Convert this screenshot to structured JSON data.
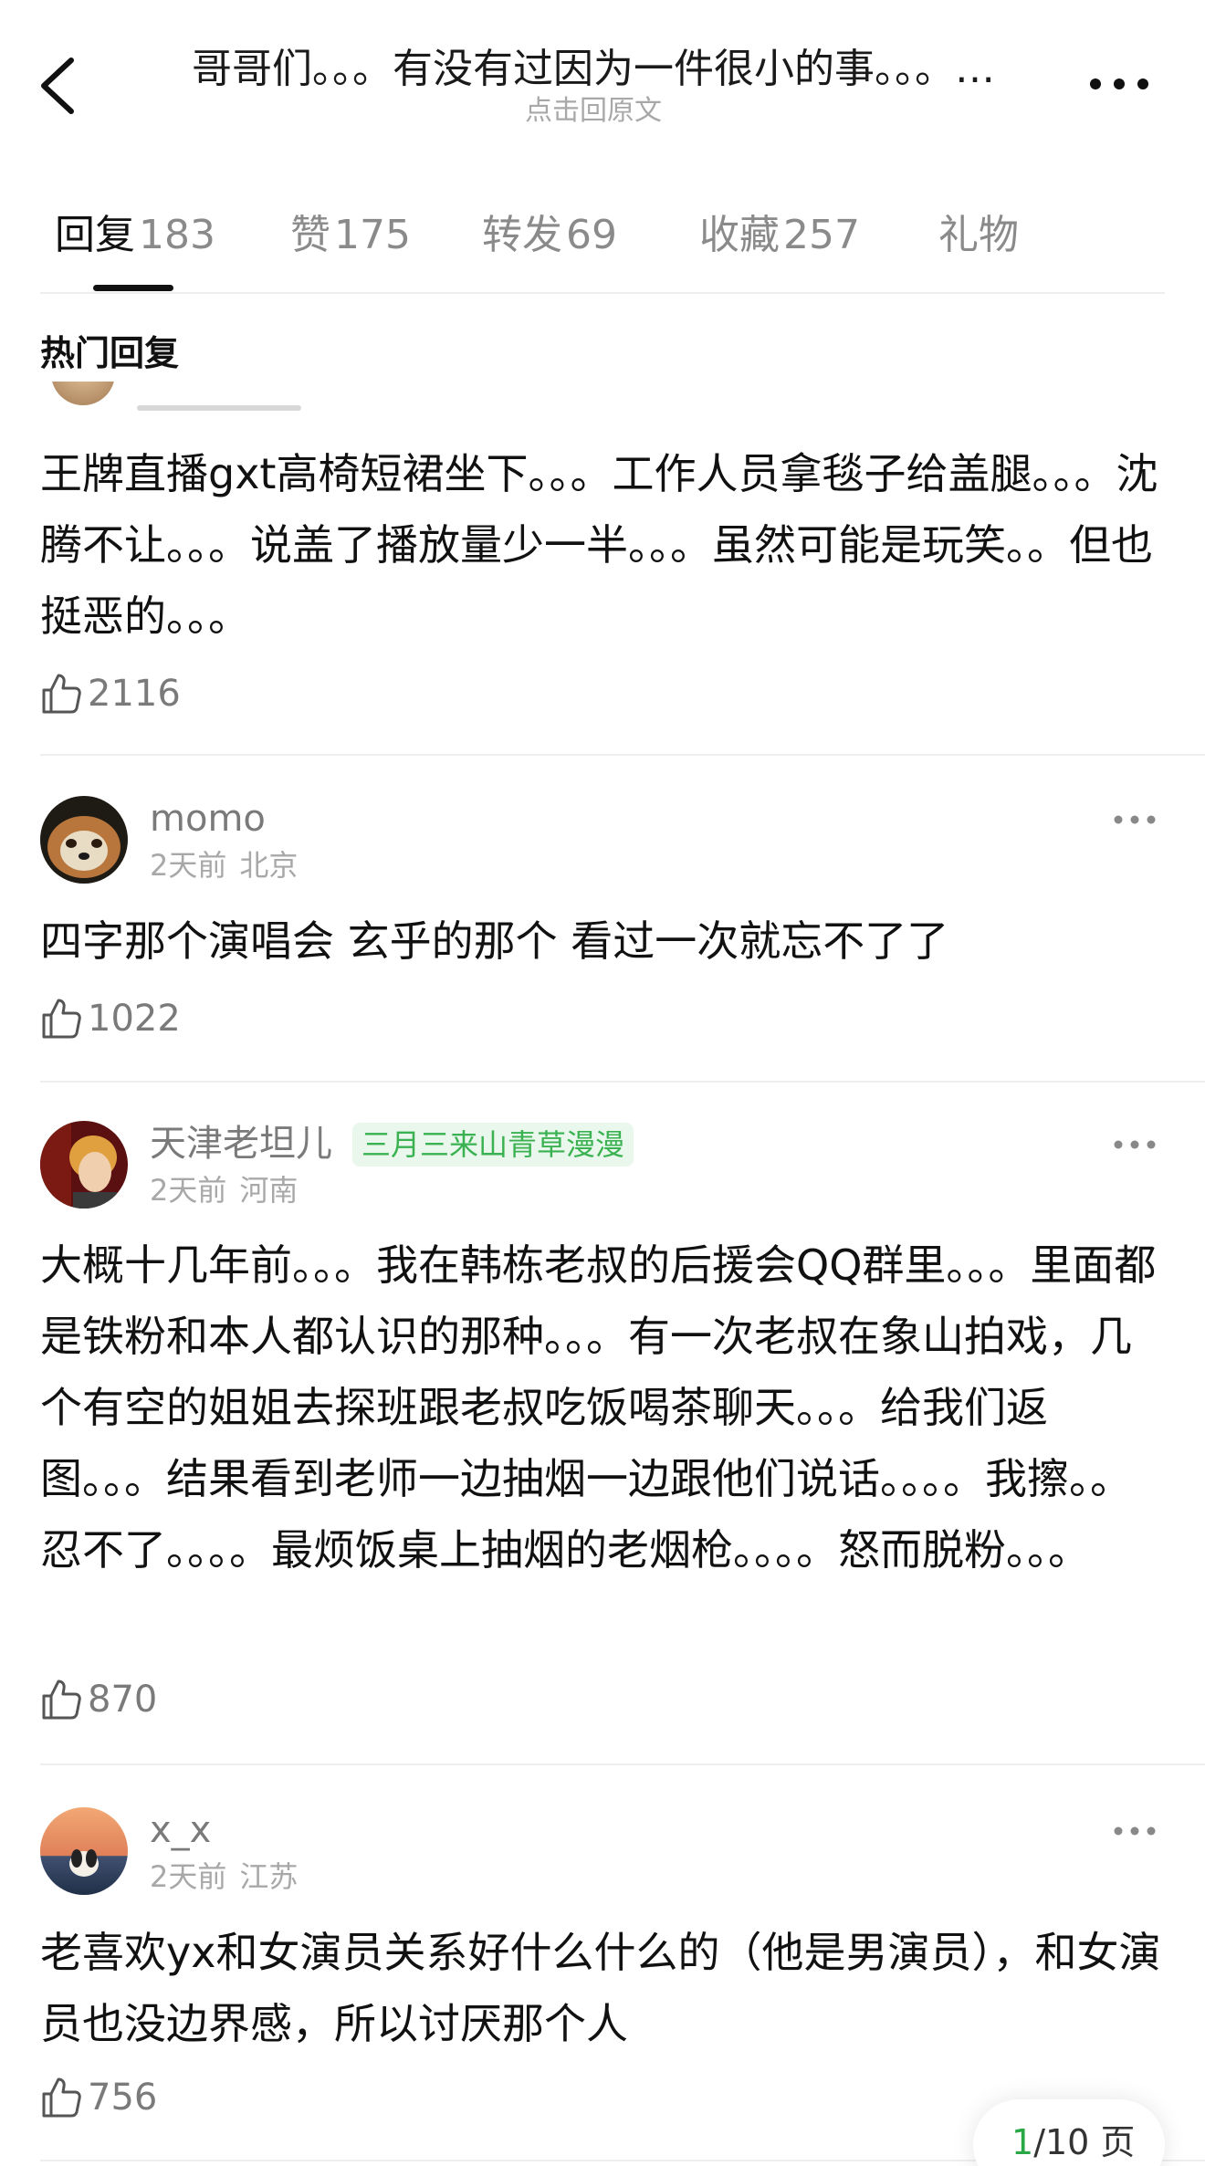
{
  "header": {
    "title": "哥哥们。。。有没有过因为一件很小的事。。。…",
    "subtitle": "点击回原文"
  },
  "tabs": [
    {
      "label": "回复",
      "count": "183"
    },
    {
      "label": "赞",
      "count": "175"
    },
    {
      "label": "转发",
      "count": "69"
    },
    {
      "label": "收藏",
      "count": "257"
    },
    {
      "label": "礼物",
      "count": ""
    }
  ],
  "section": {
    "title": "热门回复"
  },
  "comments": [
    {
      "text": "王牌直播gxt高椅短裙坐下。。。工作人员拿毯子给盖腿。。。沈腾不让。。。说盖了播放量少一半。。。虽然可能是玩笑。。但也挺恶的。。。",
      "likes": "2116"
    },
    {
      "username": "momo",
      "time": "2天前",
      "location": "北京",
      "text": "四字那个演唱会 玄乎的那个 看过一次就忘不了了",
      "likes": "1022"
    },
    {
      "username": "天津老坦儿",
      "badge": "三月三来山青草漫漫",
      "time": "2天前",
      "location": "河南",
      "text": "大概十几年前。。。我在韩栋老叔的后援会QQ群里。。。里面都是铁粉和本人都认识的那种。。。有一次老叔在象山拍戏，几个有空的姐姐去探班跟老叔吃饭喝茶聊天。。。给我们返图。。。结果看到老师一边抽烟一边跟他们说话。。。。我擦。。忍不了。。。。最烦饭桌上抽烟的老烟枪。。。。怒而脱粉。。。",
      "likes": "870"
    },
    {
      "username": "x_x",
      "time": "2天前",
      "location": "江苏",
      "text": "老喜欢yx和女演员关系好什么什么的（他是男演员），和女演员也没边界感，所以讨厌那个人",
      "likes": "756"
    }
  ],
  "pager": {
    "current": "1",
    "total_text": "/10 页"
  },
  "colors": {
    "badge_text": "#3bb252",
    "badge_bg": "#eaf7ec",
    "pager_current": "#2aa845"
  }
}
